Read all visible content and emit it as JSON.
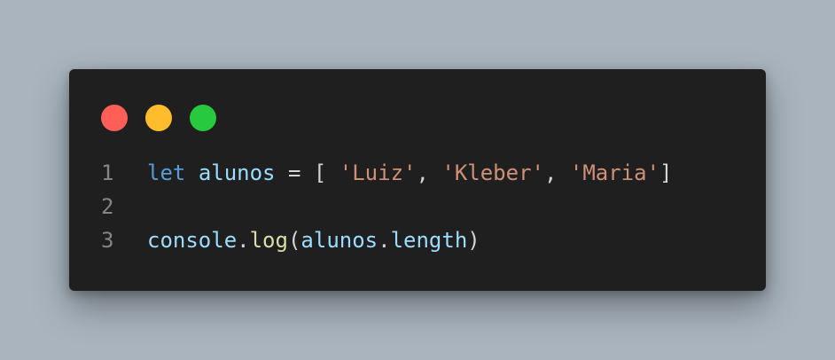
{
  "window": {
    "dots": [
      {
        "name": "close",
        "color": "#ff5f56"
      },
      {
        "name": "minimize",
        "color": "#ffbd2e"
      },
      {
        "name": "maximize",
        "color": "#27c93f"
      }
    ]
  },
  "code": {
    "lines": [
      {
        "number": "1",
        "tokens": [
          {
            "text": "let",
            "type": "keyword"
          },
          {
            "text": " ",
            "type": "punct"
          },
          {
            "text": "alunos",
            "type": "variable"
          },
          {
            "text": " = [ ",
            "type": "punct"
          },
          {
            "text": "'Luiz'",
            "type": "string"
          },
          {
            "text": ", ",
            "type": "punct"
          },
          {
            "text": "'Kleber'",
            "type": "string"
          },
          {
            "text": ", ",
            "type": "punct"
          },
          {
            "text": "'Maria'",
            "type": "string"
          },
          {
            "text": "]",
            "type": "punct"
          }
        ]
      },
      {
        "number": "2",
        "tokens": []
      },
      {
        "number": "3",
        "tokens": [
          {
            "text": "console",
            "type": "variable"
          },
          {
            "text": ".",
            "type": "punct"
          },
          {
            "text": "log",
            "type": "function"
          },
          {
            "text": "(",
            "type": "punct"
          },
          {
            "text": "alunos",
            "type": "variable"
          },
          {
            "text": ".",
            "type": "punct"
          },
          {
            "text": "length",
            "type": "variable"
          },
          {
            "text": ")",
            "type": "punct"
          }
        ]
      }
    ]
  }
}
